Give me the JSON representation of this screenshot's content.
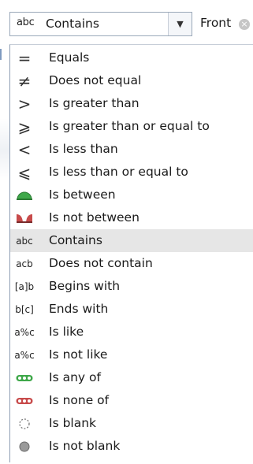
{
  "filter": {
    "condition_icon": "abc",
    "condition_value": "Contains",
    "dropdown_arrow": "▼",
    "value_text": "Front",
    "clear_glyph": "×"
  },
  "operators": [
    {
      "label": "Equals",
      "icon": "equals-icon",
      "glyph": "="
    },
    {
      "label": "Does not equal",
      "icon": "not-equal-icon",
      "glyph": "≠"
    },
    {
      "label": "Is greater than",
      "icon": "greater-than-icon",
      "glyph": ">"
    },
    {
      "label": "Is greater than or equal to",
      "icon": "greater-equal-icon",
      "glyph": "⩾"
    },
    {
      "label": "Is less than",
      "icon": "less-than-icon",
      "glyph": "<"
    },
    {
      "label": "Is less than or equal to",
      "icon": "less-equal-icon",
      "glyph": "⩽"
    },
    {
      "label": "Is between",
      "icon": "between-icon",
      "glyph": ""
    },
    {
      "label": "Is not between",
      "icon": "not-between-icon",
      "glyph": ""
    },
    {
      "label": "Contains",
      "icon": "contains-icon",
      "glyph": "abc",
      "selected": true
    },
    {
      "label": "Does not contain",
      "icon": "does-not-contain-icon",
      "glyph": "acb"
    },
    {
      "label": "Begins with",
      "icon": "begins-with-icon",
      "glyph": "[a]b"
    },
    {
      "label": "Ends with",
      "icon": "ends-with-icon",
      "glyph": "b[c]"
    },
    {
      "label": "Is like",
      "icon": "is-like-icon",
      "glyph": "a%c"
    },
    {
      "label": "Is not like",
      "icon": "is-not-like-icon",
      "glyph": "a%c"
    },
    {
      "label": "Is any of",
      "icon": "is-any-of-icon",
      "glyph": ""
    },
    {
      "label": "Is none of",
      "icon": "is-none-of-icon",
      "glyph": ""
    },
    {
      "label": "Is blank",
      "icon": "is-blank-icon",
      "glyph": ""
    },
    {
      "label": "Is not blank",
      "icon": "is-not-blank-icon",
      "glyph": ""
    }
  ],
  "colors": {
    "green": "#3fa84a",
    "red": "#c84b4b",
    "selected_bg": "#e6e6e6"
  }
}
